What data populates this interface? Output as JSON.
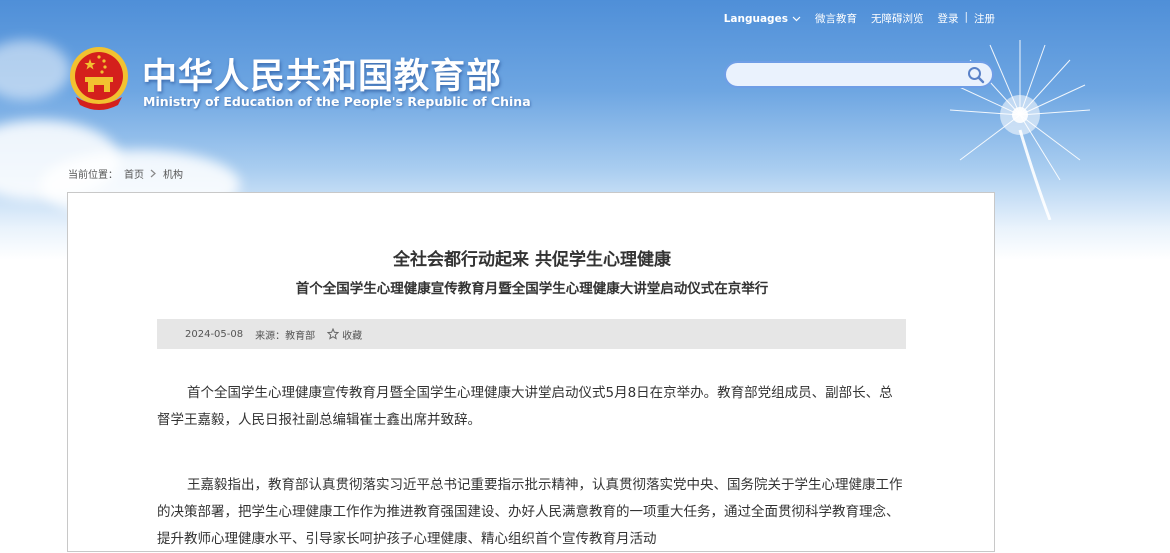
{
  "topbar": {
    "languages": "Languages",
    "weiyan": "微言教育",
    "accessibility": "无障碍浏览",
    "login": "登录",
    "separator": "|",
    "register": "注册"
  },
  "header": {
    "title_cn": "中华人民共和国教育部",
    "title_en": "Ministry of Education of the People's Republic of China"
  },
  "search": {
    "value": "",
    "placeholder": ""
  },
  "breadcrumb": {
    "label": "当前位置：",
    "home": "首页",
    "current": "机构"
  },
  "article": {
    "title": "全社会都行动起来 共促学生心理健康",
    "subtitle": "首个全国学生心理健康宣传教育月暨全国学生心理健康大讲堂启动仪式在京举行",
    "date": "2024-05-08",
    "source": "来源：教育部",
    "favorite": "收藏",
    "paragraphs": [
      "首个全国学生心理健康宣传教育月暨全国学生心理健康大讲堂启动仪式5月8日在京举办。教育部党组成员、副部长、总督学王嘉毅，人民日报社副总编辑崔士鑫出席并致辞。",
      "王嘉毅指出，教育部认真贯彻落实习近平总书记重要指示批示精神，认真贯彻落实党中央、国务院关于学生心理健康工作的决策部署，把学生心理健康工作作为推进教育强国建设、办好人民满意教育的一项重大任务，通过全面贯彻科学教育理念、提升教师心理健康水平、引导家长呵护孩子心理健康、精心组织首个宣传教育月活动"
    ]
  },
  "colors": {
    "sky_top": "#4f8fd8",
    "search_border": "#6f9ee6",
    "emblem_red": "#d4201c",
    "emblem_gold": "#f2c230"
  }
}
